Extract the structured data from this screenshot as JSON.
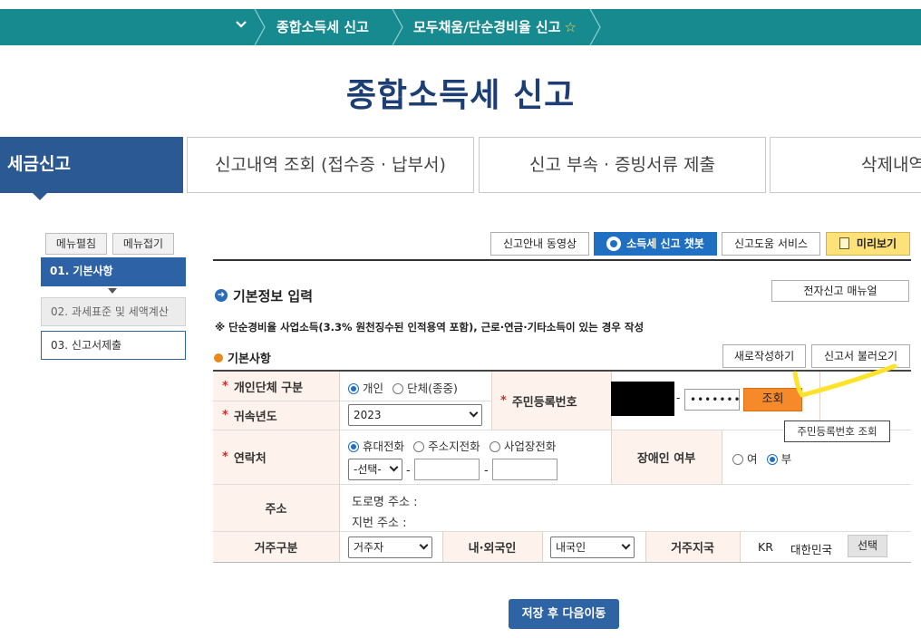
{
  "topbar": {
    "crumb1": "종합소득세 신고",
    "crumb2": "모두채움/단순경비율 신고"
  },
  "page_title": "종합소득세 신고",
  "main_tabs": [
    {
      "label": "세금신고"
    },
    {
      "label": "신고내역 조회 (접수증 · 납부서)"
    },
    {
      "label": "신고 부속 · 증빙서류 제출"
    },
    {
      "label": "삭제내역"
    }
  ],
  "sidebar": {
    "expand": "메뉴펼침",
    "collapse": "메뉴접기",
    "steps": [
      {
        "label": "01. 기본사항"
      },
      {
        "label": "02. 과세표준 및 세액계산"
      },
      {
        "label": "03. 신고서제출"
      }
    ]
  },
  "services": {
    "video": "신고안내 동영상",
    "chatbot": "소득세 신고 챗봇",
    "help": "신고도움 서비스",
    "preview": "미리보기"
  },
  "section": {
    "title": "기본정보 입력",
    "manual": "전자신고 매뉴얼",
    "notice": "※ 단순경비율 사업소득(3.3% 원천징수된 인적용역 포함), 근로·연금·기타소득이 있는 경우 작성",
    "subtitle": "기본사항",
    "new_btn": "새로작성하기",
    "load_btn": "신고서 불러오기"
  },
  "form": {
    "type_label": "개인단체 구분",
    "type_opt1": "개인",
    "type_opt2": "단체(종중)",
    "year_label": "귀속년도",
    "year_value": "2023",
    "rrn_label": "주민등록번호",
    "rrn_dash": "-",
    "rrn_masked": "•••••••",
    "lookup_btn": "조회",
    "tooltip": "주민등록번호 조회",
    "contact_label": "연락처",
    "contact_opt1": "휴대전화",
    "contact_opt2": "주소지전화",
    "contact_opt3": "사업장전화",
    "phone_select": "-선택-",
    "phone_dash1": "-",
    "phone_dash2": "-",
    "disabled_label": "장애인 여부",
    "disabled_yes": "여",
    "disabled_no": "부",
    "address_label": "주소",
    "road_addr": "도로명 주소 :",
    "lot_addr": "지번 주소 :",
    "residence_label": "거주구분",
    "residence_value": "거주자",
    "nationality_label": "내·외국인",
    "nationality_value": "내국인",
    "country_label": "거주지국",
    "country_code": "KR",
    "country_name": "대한민국",
    "select_btn": "선택"
  },
  "save_btn": "저장 후 다음이동"
}
